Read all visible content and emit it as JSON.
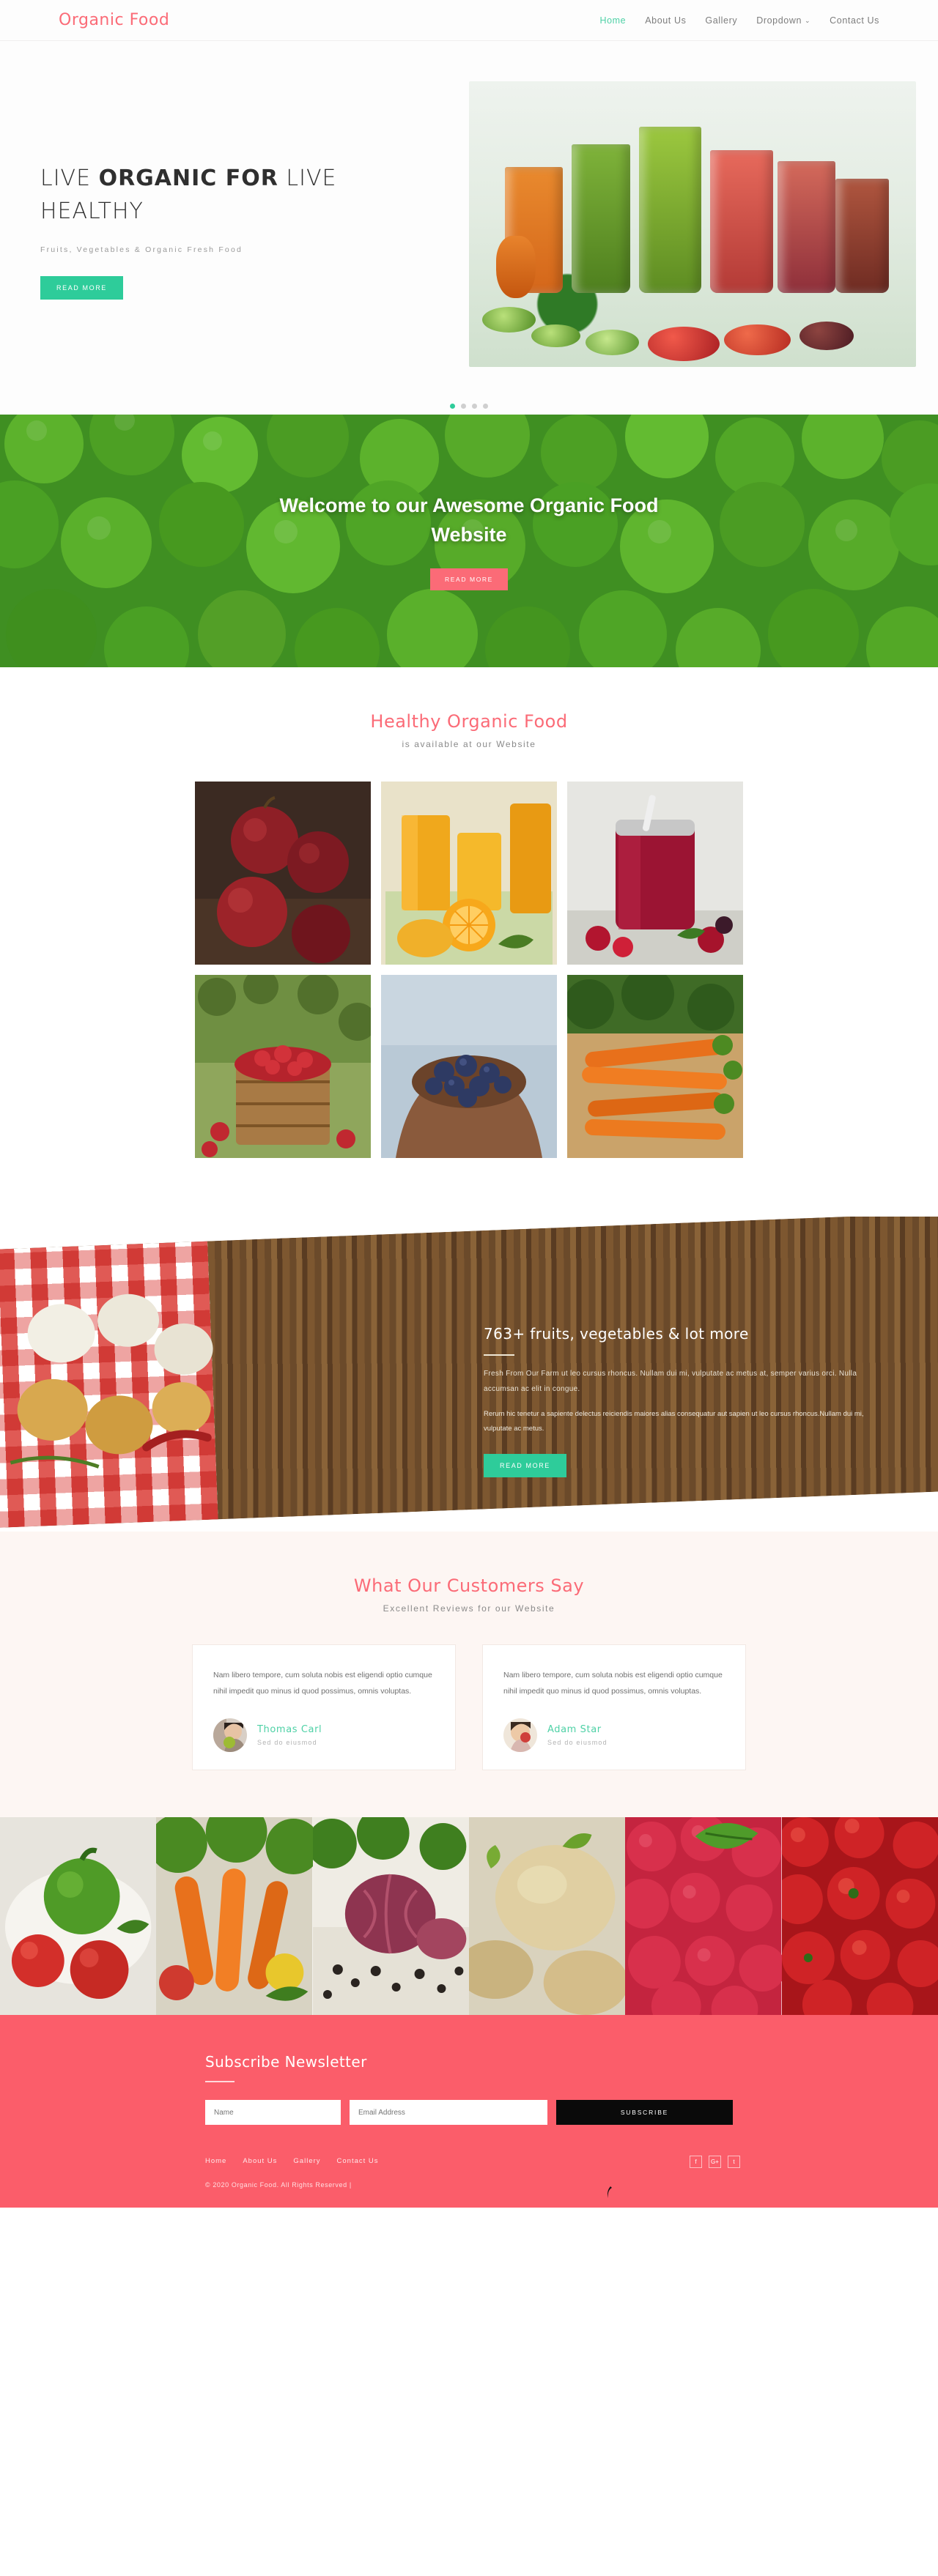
{
  "header": {
    "brand": "Organic Food",
    "nav": [
      {
        "label": "Home",
        "active": true
      },
      {
        "label": "About Us",
        "active": false
      },
      {
        "label": "Gallery",
        "active": false
      },
      {
        "label": "Dropdown",
        "active": false,
        "caret": "⌄"
      },
      {
        "label": "Contact Us",
        "active": false
      }
    ]
  },
  "hero": {
    "title_pre": "LIVE ",
    "title_bold": "ORGANIC FOR",
    "title_post": " LIVE HEALTHY",
    "subtitle": "Fruits, Vegetables & Organic Fresh Food",
    "cta": "READ MORE",
    "slides": 4,
    "active_slide": 1
  },
  "welcome": {
    "title": "Welcome to our Awesome Organic Food Website",
    "cta": "READ MORE"
  },
  "gallery": {
    "title": "Healthy Organic Food",
    "subtitle": "is available at our Website",
    "tiles": [
      {
        "alt": "red-apples-on-wood"
      },
      {
        "alt": "orange-juice-and-citrus"
      },
      {
        "alt": "berry-smoothie-mason-jar"
      },
      {
        "alt": "cranberries-in-wooden-basket"
      },
      {
        "alt": "blueberries-in-hands"
      },
      {
        "alt": "fresh-carrots-bunch"
      }
    ]
  },
  "wood": {
    "title": "763+ fruits, vegetables & lot more",
    "paragraph": "Fresh From Our Farm ut leo cursus rhoncus. Nullam dui mi, vulputate ac metus at, semper varius orci. Nulla accumsan ac elit in congue.",
    "paragraph2": "Rerum hic tenetur a sapiente delectus reiciendis maiores alias consequatur aut sapien ut leo cursus rhoncus.Nullam dui mi, vulputate ac metus.",
    "cta": "READ MORE"
  },
  "testimonials": {
    "title": "What Our Customers Say",
    "subtitle": "Excellent Reviews for our Website",
    "items": [
      {
        "quote": "Nam libero tempore, cum soluta nobis est eligendi optio cumque nihil impedit quo minus id quod possimus, omnis voluptas.",
        "name": "Thomas Carl",
        "role": "Sed do eiusmod"
      },
      {
        "quote": "Nam libero tempore, cum soluta nobis est eligendi optio cumque nihil impedit quo minus id quod possimus, omnis voluptas.",
        "name": "Adam Star",
        "role": "Sed do eiusmod"
      }
    ]
  },
  "strip": [
    {
      "alt": "green-pepper-and-tomatoes"
    },
    {
      "alt": "carrots-and-vegetables"
    },
    {
      "alt": "red-onion-and-peppercorns"
    },
    {
      "alt": "potatoes-and-turnip"
    },
    {
      "alt": "raspberries-with-leaf"
    },
    {
      "alt": "cherry-tomatoes"
    }
  ],
  "newsletter": {
    "title": "Subscribe Newsletter",
    "name_placeholder": "Name",
    "email_placeholder": "Email Address",
    "submit": "SUBSCRIBE"
  },
  "footer": {
    "nav": [
      "Home",
      "About Us",
      "Gallery",
      "Contact Us"
    ],
    "copyright": "© 2020 Organic Food. All Rights Reserved |",
    "socials": [
      {
        "name": "facebook-icon",
        "glyph": "f"
      },
      {
        "name": "google-plus-icon",
        "glyph": "G+"
      },
      {
        "name": "twitter-icon",
        "glyph": "t"
      }
    ]
  },
  "colors": {
    "brand_pink": "#fb6b77",
    "accent_teal": "#2ecc9a",
    "newsletter_bg": "#fb5d6a",
    "dark_button": "#0a0a0a"
  }
}
